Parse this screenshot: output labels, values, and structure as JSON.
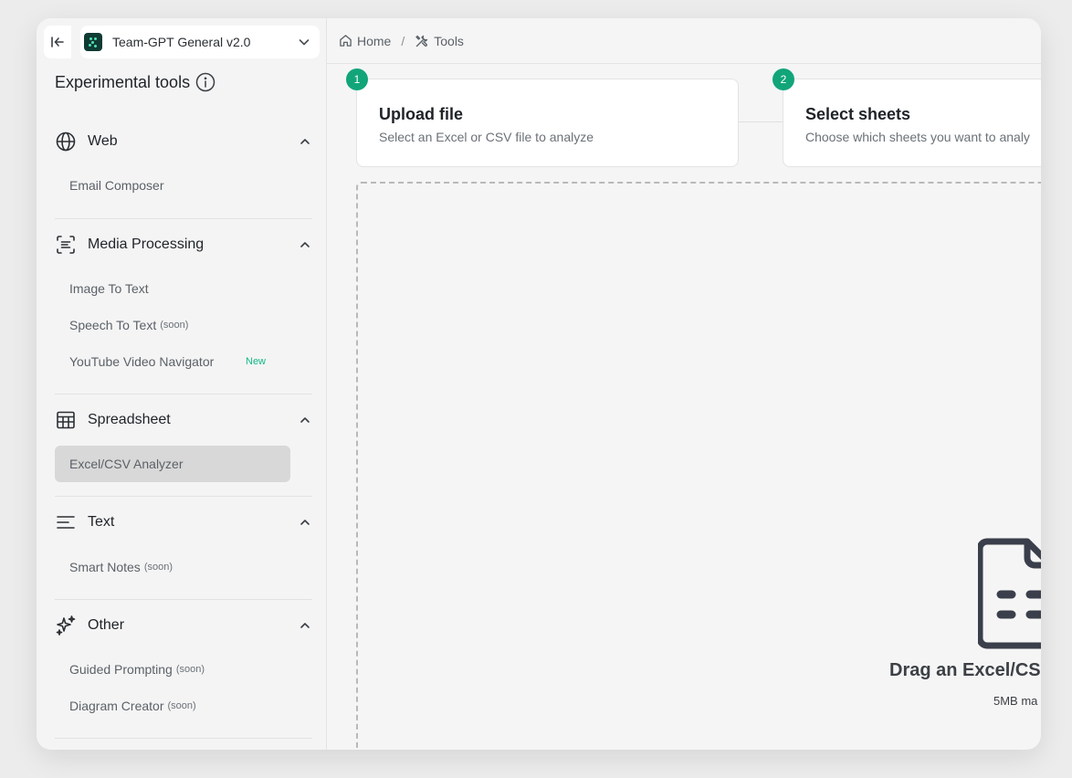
{
  "workspace": {
    "name": "Team-GPT General v2.0"
  },
  "sidebar": {
    "title": "Experimental tools",
    "sections": [
      {
        "label": "Web",
        "items": [
          {
            "label": "Email Composer"
          }
        ]
      },
      {
        "label": "Media Processing",
        "items": [
          {
            "label": "Image To Text"
          },
          {
            "label": "Speech To Text",
            "tag": "(soon)"
          },
          {
            "label": "YouTube Video Navigator",
            "badge": "New"
          }
        ]
      },
      {
        "label": "Spreadsheet",
        "items": [
          {
            "label": "Excel/CSV Analyzer",
            "active": true
          }
        ]
      },
      {
        "label": "Text",
        "items": [
          {
            "label": "Smart Notes",
            "tag": "(soon)"
          }
        ]
      },
      {
        "label": "Other",
        "items": [
          {
            "label": "Guided Prompting",
            "tag": "(soon)"
          },
          {
            "label": "Diagram Creator",
            "tag": "(soon)"
          }
        ]
      }
    ]
  },
  "breadcrumb": {
    "home": "Home",
    "separator": "/",
    "current": "Tools"
  },
  "steps": [
    {
      "number": "1",
      "title": "Upload file",
      "description": "Select an Excel or CSV file to analyze"
    },
    {
      "number": "2",
      "title": "Select sheets",
      "description": "Choose which sheets you want to analy"
    }
  ],
  "dropzone": {
    "text": "Drag an Excel/CS",
    "subtext": "5MB ma"
  },
  "colors": {
    "accent": "#12a579",
    "new_badge": "#12b886",
    "active_item": "#d8d8d8"
  }
}
